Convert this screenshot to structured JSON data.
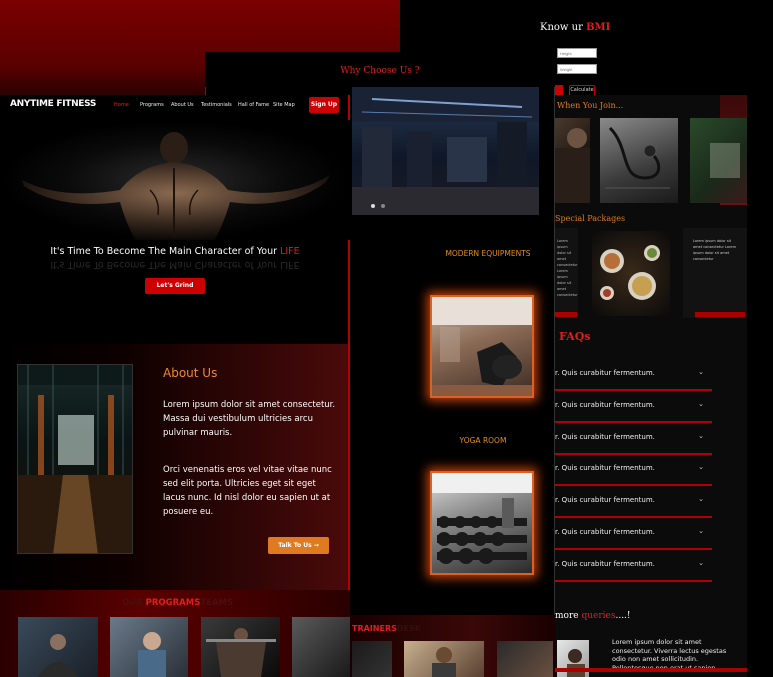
{
  "bmi": {
    "title_prefix": "Know ",
    "title_suffix": "ur ",
    "title_accent": "BMI",
    "height_placeholder": "Height",
    "weight_placeholder": "Weight",
    "button_label": "Calculate"
  },
  "right_panel": {
    "join_heading": "When You Join...",
    "packages_heading": "Special Packages",
    "package_text": "Lorem ipsum dolor sit amet consectetur Lorem ipsum dolor sit amet consectetur",
    "faq_title": "FAQs",
    "faq_items": [
      "r. Quis curabitur fermentum.",
      "r. Quis curabitur fermentum.",
      "r. Quis curabitur fermentum.",
      "r. Quis curabitur fermentum.",
      "r. Quis curabitur fermentum.",
      "r. Quis curabitur fermentum.",
      "r. Quis curabitur fermentum."
    ],
    "more_prefix": "more ",
    "more_accent": "queries",
    "more_suffix": "....!",
    "contact_text": "Lorem ipsum dolor sit amet consectetur. Viverra lectus egestas odio non amet sollicitudin. Pellentesque non erat ut sapien"
  },
  "middle": {
    "why_title": "Why Choose Us ?",
    "label_modern": "MODERN EQUIPMENTS",
    "label_yoga": "YOGA ROOM",
    "trainers_accent": "TRAINERS",
    "trainers_faded": "DESK"
  },
  "nav": {
    "logo": "ANYTIME FITNESS",
    "items": [
      "Home",
      "Programs",
      "About Us",
      "Testimonials",
      "Hall of Fame",
      "Site Map"
    ],
    "signup": "Sign Up"
  },
  "hero": {
    "text_prefix": "It's Time To Become The Main Character of Your ",
    "text_accent": "LIFE",
    "cta": "Let's Grind"
  },
  "about": {
    "title": "About Us",
    "p1": "Lorem ipsum dolor sit amet consectetur. Massa dui vestibulum ultricies arcu pulvinar mauris.",
    "p2": "Orci venenatis eros vel vitae vitae nunc sed elit porta. Ultricies eget sit eget lacus nunc. Id nisl dolor eu sapien ut at posuere eu.",
    "cta": "Talk To Us →"
  },
  "programs": {
    "faded_left": "OUR",
    "accent": "PROGRAMS",
    "faded_right": "TEAMS"
  },
  "colors": {
    "accent_red": "#e11d1d",
    "accent_orange": "#e07a20",
    "background": "#000000"
  }
}
